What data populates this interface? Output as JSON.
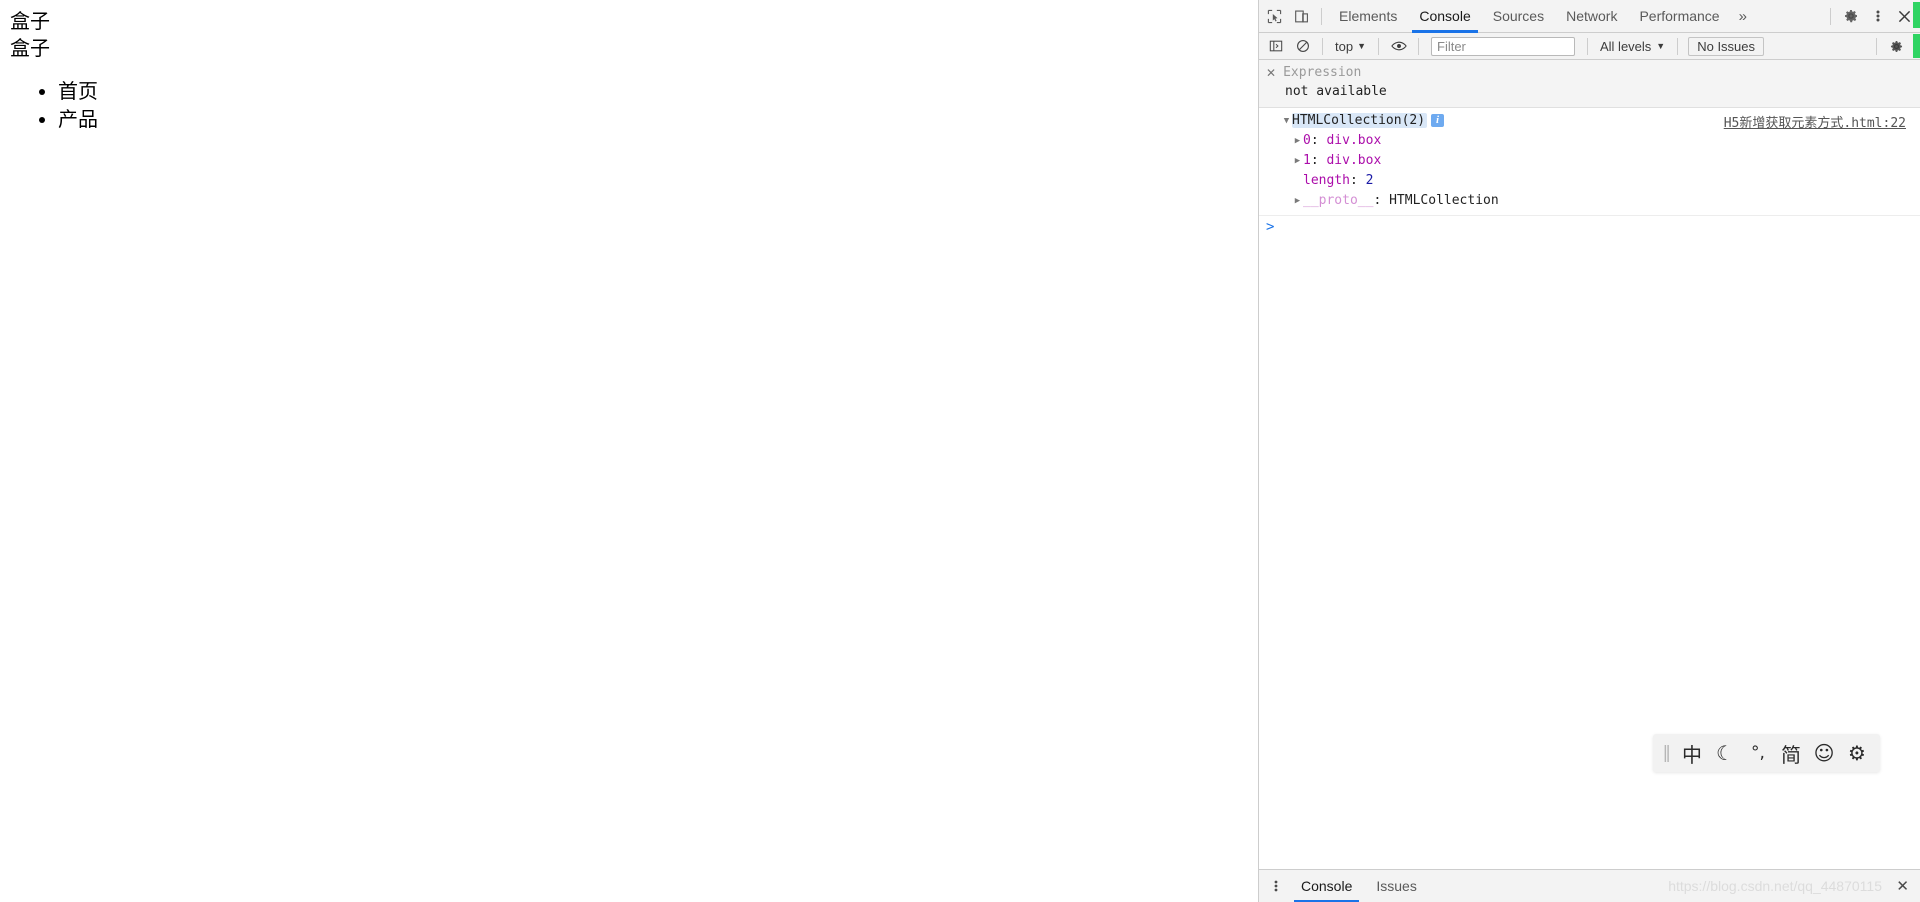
{
  "page": {
    "box_lines": [
      "盒子",
      "盒子"
    ],
    "nav_items": [
      "首页",
      "产品"
    ]
  },
  "devtools": {
    "toolbar_icons": {
      "inspect": "inspect-element-icon",
      "device": "device-toolbar-icon"
    },
    "tabs": [
      {
        "label": "Elements",
        "active": false
      },
      {
        "label": "Console",
        "active": true
      },
      {
        "label": "Sources",
        "active": false
      },
      {
        "label": "Network",
        "active": false
      },
      {
        "label": "Performance",
        "active": false
      }
    ],
    "overflow_label": "»",
    "settings_icon": "gear-icon",
    "more_icon": "kebab-menu-icon",
    "close_icon": "close-icon",
    "console_toolbar": {
      "sidebar_toggle_icon": "console-sidebar-icon",
      "clear_icon": "clear-console-icon",
      "context_value": "top",
      "context_caret": "▼",
      "eye_icon": "live-expression-eye-icon",
      "filter_placeholder": "Filter",
      "filter_value": "",
      "level_value": "All levels",
      "level_caret": "▼",
      "issues_label": "No Issues",
      "settings_icon": "console-settings-gear-icon"
    },
    "live_expression": {
      "close_glyph": "✕",
      "name": "Expression",
      "value": "not available"
    },
    "console_output": {
      "source_link": "H5新增获取元素方式.html:22",
      "object_header": "HTMLCollection(2)",
      "info_badge": "i",
      "expand_glyph_open": "▼",
      "expand_glyph_closed": "▶",
      "properties": [
        {
          "key": "0",
          "sep": ":",
          "value": "div.box",
          "kind": "object"
        },
        {
          "key": "1",
          "sep": ":",
          "value": "div.box",
          "kind": "object"
        },
        {
          "key": "length",
          "sep": ":",
          "value": "2",
          "kind": "number"
        },
        {
          "key": "__proto__",
          "sep": ":",
          "value": "HTMLCollection",
          "kind": "proto"
        }
      ]
    },
    "prompt": {
      "caret": ">",
      "value": "",
      "placeholder": ""
    },
    "drawer": {
      "more_icon": "kebab-menu-icon",
      "tabs": [
        {
          "label": "Console",
          "active": true
        },
        {
          "label": "Issues",
          "active": false
        }
      ],
      "close_glyph": "✕",
      "watermark": "https://blog.csdn.net/qq_44870115"
    }
  },
  "ime_bar": {
    "handle": "‖",
    "items": [
      {
        "glyph": "中",
        "name": "language-mode-chinese"
      },
      {
        "glyph": "☾",
        "name": "moon-shape-icon"
      },
      {
        "glyph": "°,",
        "name": "punctuation-mode-icon"
      },
      {
        "glyph": "简",
        "name": "simplified-chinese-icon"
      },
      {
        "glyph": "☺",
        "name": "emoji-icon"
      },
      {
        "glyph": "⚙",
        "name": "ime-settings-gear-icon"
      }
    ]
  },
  "colors": {
    "accent": "#1a73e8",
    "toolbar_bg": "#f3f3f3",
    "green_indicator": "#2fd463",
    "key_purple": "#ab0daa",
    "number_blue": "#1a1aa6"
  }
}
